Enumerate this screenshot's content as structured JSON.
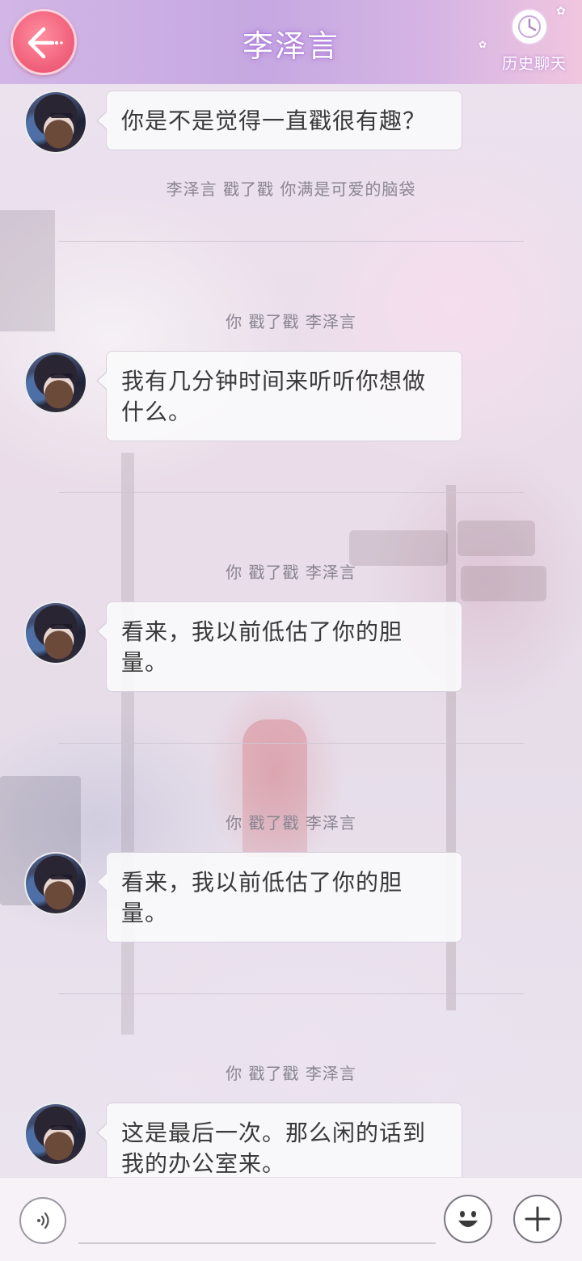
{
  "header": {
    "title": "李泽言",
    "back_icon": "back-arrow-icon",
    "history_label": "历史聊天",
    "history_icon": "clock-icon"
  },
  "chat": {
    "messages": [
      {
        "type": "bubble",
        "text": "你是不是觉得一直戳很有趣？"
      },
      {
        "type": "system",
        "text": "李泽言 戳了戳 你满是可爱的脑袋"
      },
      {
        "type": "system",
        "text": "你 戳了戳 李泽言"
      },
      {
        "type": "bubble",
        "text": "我有几分钟时间来听听你想做什么。"
      },
      {
        "type": "system",
        "text": "你 戳了戳 李泽言"
      },
      {
        "type": "bubble",
        "text": "看来，我以前低估了你的胆量。"
      },
      {
        "type": "system",
        "text": "你 戳了戳 李泽言"
      },
      {
        "type": "bubble",
        "text": "看来，我以前低估了你的胆量。"
      },
      {
        "type": "system",
        "text": "你 戳了戳 李泽言"
      },
      {
        "type": "bubble",
        "text": "这是最后一次。那么闲的话到我的办公室来。"
      }
    ]
  },
  "input_bar": {
    "voice_icon": "voice-icon",
    "text_value": "",
    "emoji_icon": "emoji-icon",
    "plus_icon": "plus-icon"
  },
  "colors": {
    "header_gradient_start": "#d2b6e6",
    "header_gradient_end": "#f0c6df",
    "back_button": "#ef5d78",
    "bubble_bg": "#faf9fb",
    "system_text": "#8a8591"
  }
}
